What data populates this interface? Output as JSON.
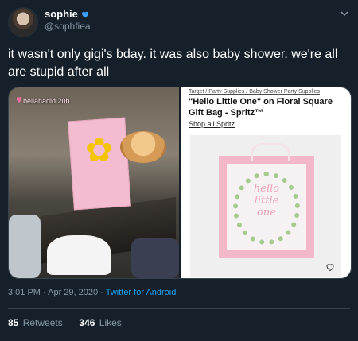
{
  "user": {
    "name": "sophie",
    "handle": "@sophfiea"
  },
  "tweet": {
    "text": "it wasn't only gigi's bday. it was also baby shower. we're all are stupid after all"
  },
  "photo": {
    "tag_text": "bellahadid  20h"
  },
  "product": {
    "breadcrumb": "Target / Party Supplies / Baby Shower Party Supplies",
    "title": "\"Hello Little One\" on Floral Square Gift Bag - Spritz™",
    "shop_all": "Shop all Spritz",
    "bag_text": [
      "hello",
      "little",
      "one"
    ]
  },
  "meta": {
    "time": "3:01 PM · Apr 29, 2020 · ",
    "source": "Twitter for Android"
  },
  "stats": {
    "retweets": "85",
    "retweets_label": "Retweets",
    "likes": "346",
    "likes_label": "Likes"
  },
  "colors": {
    "background": "#15202b",
    "verified_heart": "#3aa0ff",
    "link": "#1da1f2",
    "muted": "#8899a6"
  }
}
